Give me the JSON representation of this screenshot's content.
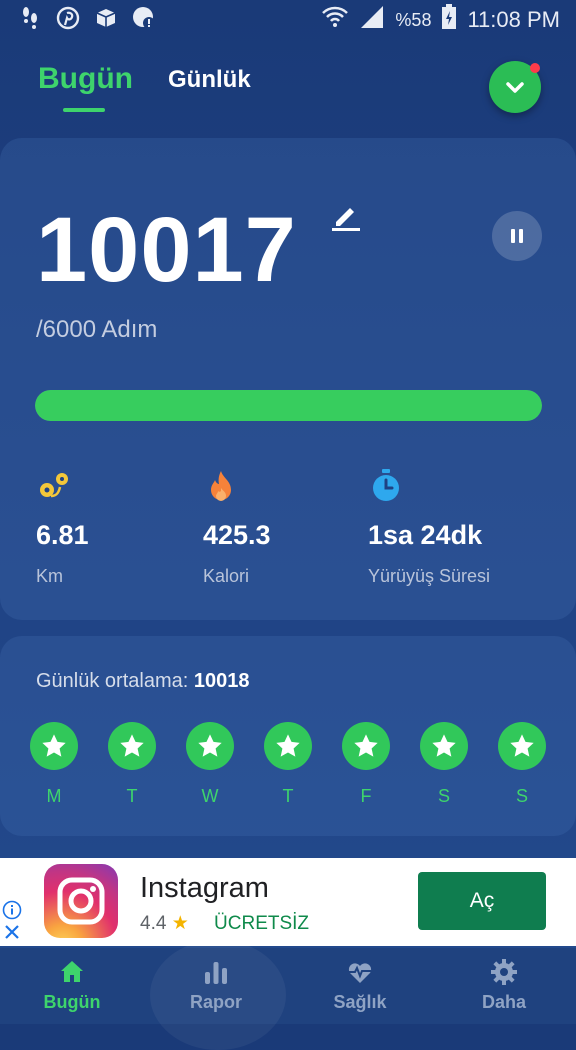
{
  "status_bar": {
    "battery_percent": "%58",
    "time": "11:08 PM"
  },
  "tabs": [
    {
      "label": "Bugün",
      "active": true
    },
    {
      "label": "Günlük",
      "active": false
    }
  ],
  "steps": {
    "count": "10017",
    "goal_text": "/6000 Adım",
    "progress_fraction": 1.0
  },
  "stats": [
    {
      "icon": "distance-icon",
      "value": "6.81",
      "label": "Km"
    },
    {
      "icon": "flame-icon",
      "value": "425.3",
      "label": "Kalori"
    },
    {
      "icon": "stopwatch-icon",
      "value": "1sa 24dk",
      "label": "Yürüyüş Süresi"
    }
  ],
  "weekly": {
    "avg_label": "Günlük ortalama: ",
    "avg_value": "10018",
    "days": [
      "M",
      "T",
      "W",
      "T",
      "F",
      "S",
      "S"
    ]
  },
  "ad": {
    "title": "Instagram",
    "rating": "4.4",
    "price": "ÜCRETSİZ",
    "button": "Aç"
  },
  "nav": [
    {
      "label": "Bugün",
      "icon": "home-icon",
      "active": true
    },
    {
      "label": "Rapor",
      "icon": "bar-chart-icon",
      "active": false
    },
    {
      "label": "Sağlık",
      "icon": "heart-pulse-icon",
      "active": false
    },
    {
      "label": "Daha",
      "icon": "gear-icon",
      "active": false
    }
  ],
  "colors": {
    "accent": "#3ed46c",
    "background": "#1f4283",
    "ad_button": "#0f7d4f"
  }
}
